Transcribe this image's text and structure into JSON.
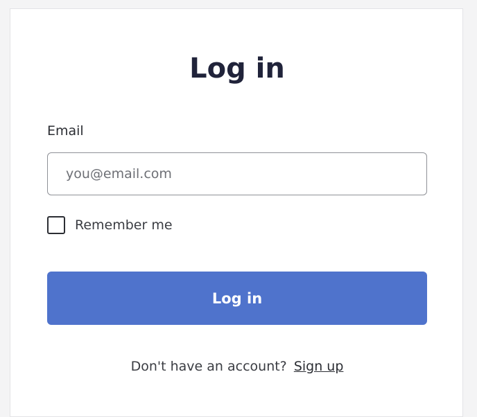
{
  "login_form": {
    "title": "Log in",
    "email": {
      "label": "Email",
      "placeholder": "you@email.com",
      "value": ""
    },
    "remember_me": {
      "label": "Remember me",
      "checked": false
    },
    "submit_label": "Log in",
    "signup_prompt": "Don't have an account?",
    "signup_link": "Sign up"
  },
  "colors": {
    "accent": "#4f73cc",
    "title_text": "#20233a",
    "background": "#f4f4f5"
  }
}
